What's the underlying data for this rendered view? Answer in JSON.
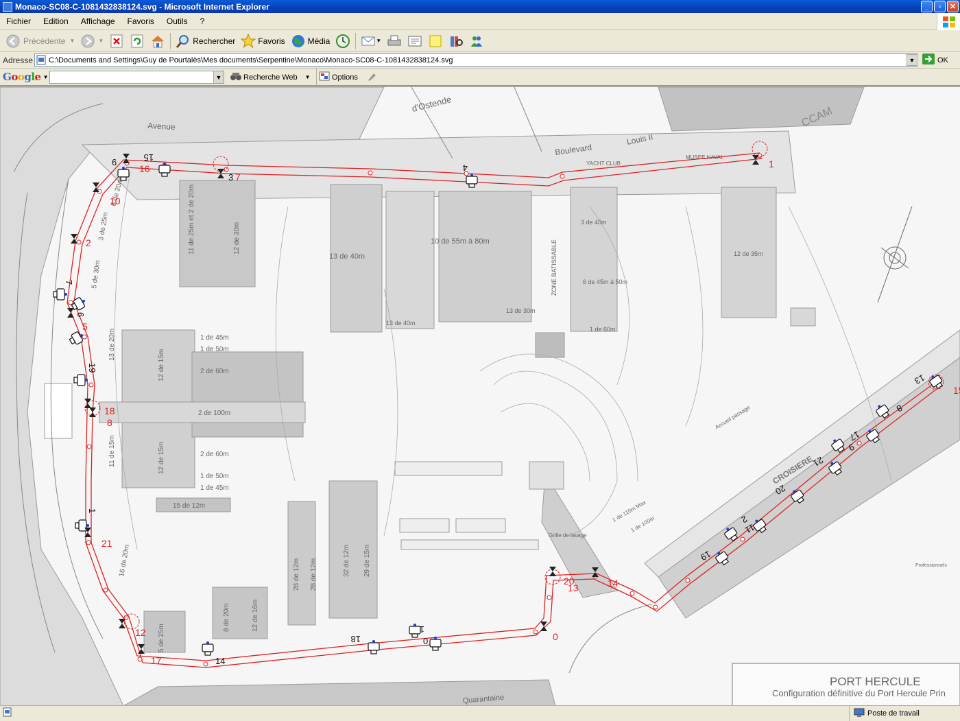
{
  "window": {
    "title": "Monaco-SC08-C-1081432838124.svg - Microsoft Internet Explorer"
  },
  "menu": [
    "Fichier",
    "Edition",
    "Affichage",
    "Favoris",
    "Outils",
    "?"
  ],
  "toolbar": {
    "back_label": "Précédente",
    "search_label": "Rechercher",
    "favorites_label": "Favoris",
    "media_label": "Média"
  },
  "address": {
    "label": "Adresse",
    "value": "C:\\Documents and Settings\\Guy de Pourtalès\\Mes documents\\Serpentine\\Monaco\\Monaco-SC08-C-1081432838124.svg",
    "go_label": "OK"
  },
  "google": {
    "logo": "Google",
    "search_label": "Recherche Web",
    "options_label": "Options"
  },
  "map": {
    "street_labels": [
      "Avenue",
      "d'Ostende",
      "Boulevard",
      "Louis II",
      "CCAM",
      "YACHT CLUB",
      "MUSEE NAVAL",
      "Quarantaine",
      "CROISIERE",
      "Accueil passage",
      "Professionnels",
      "Grille de lavage"
    ],
    "berth_labels": [
      "11 de 25m et 2 de 20m",
      "12 de 30m",
      "13 de 40m",
      "10 de 55m à 80m",
      "ZONE BATISSABLE",
      "3 de 40m",
      "6 de 45m à 50m",
      "12 de 35m",
      "13 de 40m",
      "13 de 30m",
      "1 de 60m",
      "1 de 45m",
      "1 de 50m",
      "2 de 60m",
      "2 de 100m",
      "2 de 60m",
      "1 de 50m",
      "1 de 45m",
      "15 de 12m",
      "13 de 20m",
      "12 de 15m",
      "11 de 15m",
      "12 de 15m",
      "16 de 20m",
      "5 de 25m",
      "8 de 20m",
      "12 de 16m",
      "28 de 12m",
      "28 de 12m",
      "32 de 12m",
      "29 de 15m",
      "3 de 25m",
      "5 de 30m",
      "6 de 20m",
      "1 de 110m Max",
      "1 de 100m"
    ],
    "title": "PORT HERCULE",
    "subtitle": "Configuration définitive du Port Hercule Prin"
  },
  "track_labels": {
    "red": [
      "1",
      "2",
      "10",
      "16",
      "7",
      "5",
      "18",
      "8",
      "21",
      "12",
      "17",
      "14",
      "0",
      "20",
      "13",
      "14",
      "15"
    ],
    "black": [
      "6",
      "15",
      "3",
      "4",
      "7",
      "6",
      "19",
      "1",
      "18",
      "12",
      "10",
      "13",
      "8",
      "17",
      "9",
      "21",
      "20",
      "2",
      "11",
      "19",
      "0",
      "14"
    ]
  },
  "status": {
    "zone_label": "Poste de travail"
  }
}
